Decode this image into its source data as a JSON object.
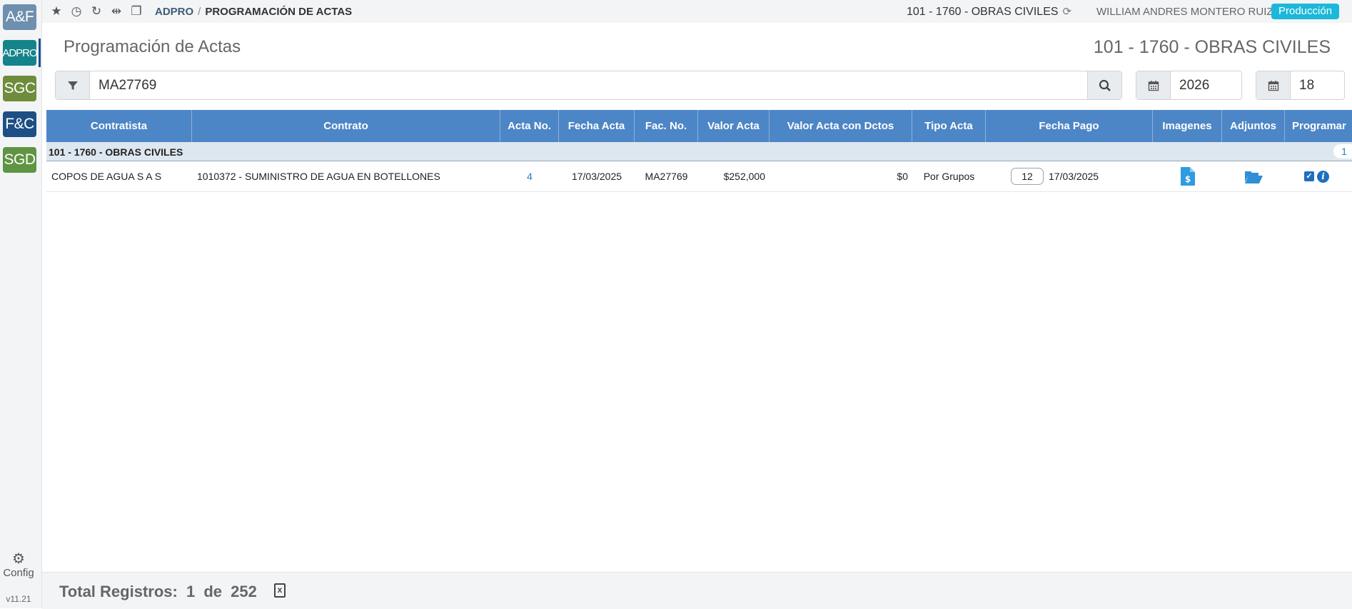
{
  "rail": {
    "apps": [
      {
        "label": "A&F",
        "color": "#6e8fae"
      },
      {
        "label": "ADPRO",
        "color": "#14848a"
      },
      {
        "label": "SGC",
        "color": "#6e8c3b"
      },
      {
        "label": "F&C",
        "color": "#1d4f84"
      },
      {
        "label": "SGD",
        "color": "#5f9442"
      }
    ],
    "config_label": "Config",
    "version": "v11.21"
  },
  "topbar": {
    "icons": [
      "star-icon",
      "history-icon",
      "refresh-icon",
      "split-view-icon",
      "windows-icon"
    ],
    "breadcrumb_root": "ADPRO",
    "breadcrumb_sep": "/",
    "breadcrumb_current": "PROGRAMACIÓN DE ACTAS",
    "company": "101 - 1760 - OBRAS CIVILES",
    "user": "WILLIAM ANDRES MONTERO RUIZ",
    "environment": "Producción"
  },
  "page": {
    "title": "Programación de Actas",
    "company": "101 - 1760 - OBRAS CIVILES"
  },
  "filters": {
    "search_value": "MA27769",
    "year_value": "2026",
    "period_value": "18"
  },
  "table": {
    "columns": [
      "Contratista",
      "Contrato",
      "Acta No.",
      "Fecha Acta",
      "Fac. No.",
      "Valor Acta",
      "Valor Acta con Dctos",
      "Tipo Acta",
      "Fecha Pago",
      "Imagenes",
      "Adjuntos",
      "Programar"
    ],
    "group": {
      "label": "101 - 1760 - OBRAS CIVILES",
      "count": "1"
    },
    "rows": [
      {
        "contratista": "COPOS DE AGUA S A S",
        "contrato": "1010372 - SUMINISTRO DE AGUA EN BOTELLONES",
        "acta_no": "4",
        "fecha_acta": "17/03/2025",
        "fac_no": "MA27769",
        "valor_acta": "$252,000",
        "valor_dctos": "$0",
        "tipo_acta": "Por Grupos",
        "pago_dias": "12",
        "fecha_pago": "17/03/2025",
        "programar_checked": true
      }
    ]
  },
  "footer": {
    "total_label": "Total Registros:",
    "shown": "1",
    "of_label": "de",
    "total": "252"
  }
}
